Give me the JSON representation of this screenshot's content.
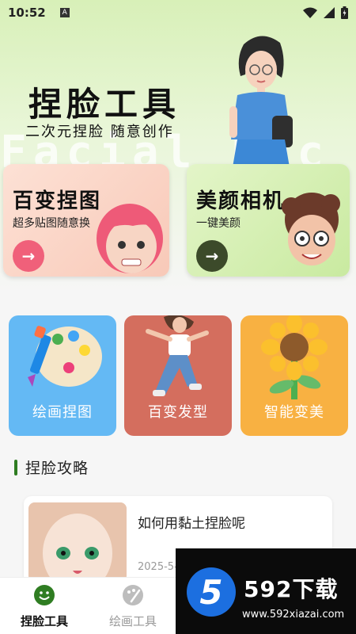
{
  "status": {
    "time": "10:52",
    "a_badge": "A"
  },
  "hero": {
    "title": "捏脸工具",
    "subtitle": "二次元捏脸 随意创作",
    "bg_text": "Facial Enc"
  },
  "cards": [
    {
      "title": "百变捏图",
      "subtitle": "超多贴图随意换",
      "arrow": "→"
    },
    {
      "title": "美颜相机",
      "subtitle": "一键美颜",
      "arrow": "→"
    }
  ],
  "tools": [
    {
      "label": "绘画捏图"
    },
    {
      "label": "百变发型"
    },
    {
      "label": "智能变美"
    }
  ],
  "section": {
    "title": "捏脸攻略"
  },
  "article": {
    "title": "如何用黏土捏脸呢",
    "date": "2025-5-"
  },
  "tabs": [
    {
      "label": "捏脸工具"
    },
    {
      "label": "绘画工具"
    }
  ],
  "watermark": {
    "digit": "5",
    "brand": "592下载",
    "url": "www.592xiazai.com"
  }
}
